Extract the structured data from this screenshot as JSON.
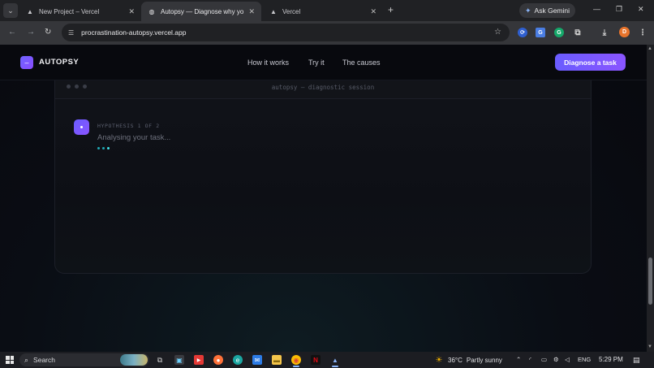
{
  "browser": {
    "tabs": [
      {
        "title": "New Project – Vercel",
        "favicon": "vercel-triangle-icon",
        "active": false
      },
      {
        "title": "Autopsy — Diagnose why you'r",
        "favicon": "globe-icon",
        "active": true
      },
      {
        "title": "Vercel",
        "favicon": "vercel-triangle-icon",
        "active": false
      }
    ],
    "new_tab_glyph": "+",
    "gemini_label": "Ask Gemini",
    "url": "procrastination-autopsy.vercel.app",
    "profile_initial": "D"
  },
  "site": {
    "logo_glyph": "–",
    "logo_text": "AUTOPSY",
    "nav": [
      {
        "label": "How it works"
      },
      {
        "label": "Try it"
      },
      {
        "label": "The causes"
      }
    ],
    "cta_label": "Diagnose a task",
    "session_title": "autopsy — diagnostic session",
    "hypothesis_label": "HYPOTHESIS 1 OF 2",
    "status_text": "Analysing your task..."
  },
  "taskbar": {
    "search_label": "Search",
    "weather_temp": "36°C",
    "weather_condition": "Partly sunny",
    "language": "ENG",
    "time": "5:29 PM"
  },
  "colors": {
    "accent": "#6a5cff",
    "accent_end": "#8a55ff",
    "typing_dot": "#3ee0e6",
    "page_bg": "#0b0d13"
  }
}
